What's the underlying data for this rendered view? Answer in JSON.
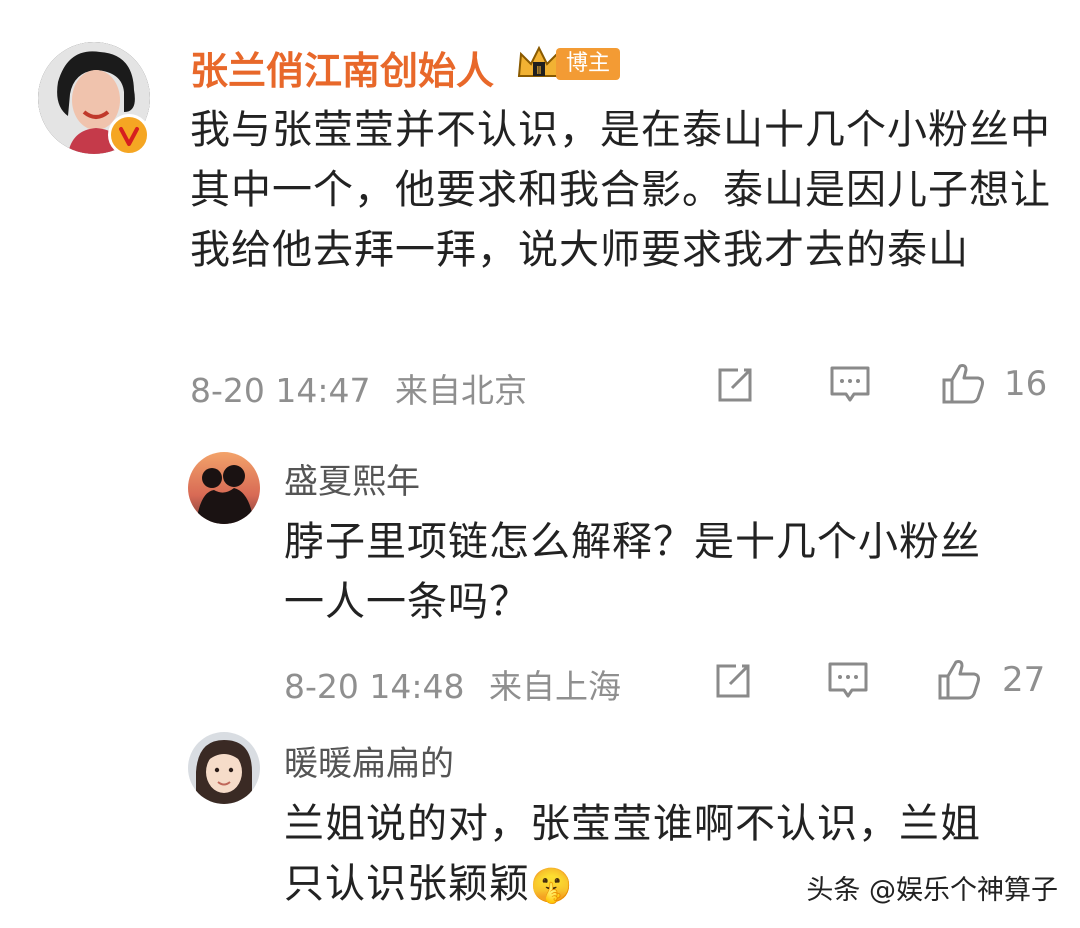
{
  "comments": [
    {
      "author": "张兰俏江南创始人",
      "badge_label": "博主",
      "text": "我与张莹莹并不认识，是在泰山十几个小粉丝中其中一个，他要求和我合影。泰山是因儿子想让我给他去拜一拜，说大师要求我才去的泰山",
      "time": "8-20 14:47",
      "location": "来自北京",
      "likes": "16"
    },
    {
      "author": "盛夏熙年",
      "text": "脖子里项链怎么解释？是十几个小粉丝一人一条吗？",
      "time": "8-20 14:48",
      "location": "来自上海",
      "likes": "27"
    },
    {
      "author": "暖暖扁扁的",
      "text": "兰姐说的对，张莹莹谁啊不认识，兰姐只认识张颖颖",
      "emoji": "🤫"
    }
  ],
  "watermark": "头条 @娱乐个神算子",
  "colors": {
    "author_highlight": "#e8682a",
    "author_normal": "#555555",
    "meta_gray": "#8f8f8f",
    "verified_badge": "#f5a623",
    "blogger_tag": "#f39b34"
  },
  "icons": [
    "verified-v-icon",
    "crown-badge-icon",
    "share-icon",
    "comment-icon",
    "like-icon"
  ]
}
